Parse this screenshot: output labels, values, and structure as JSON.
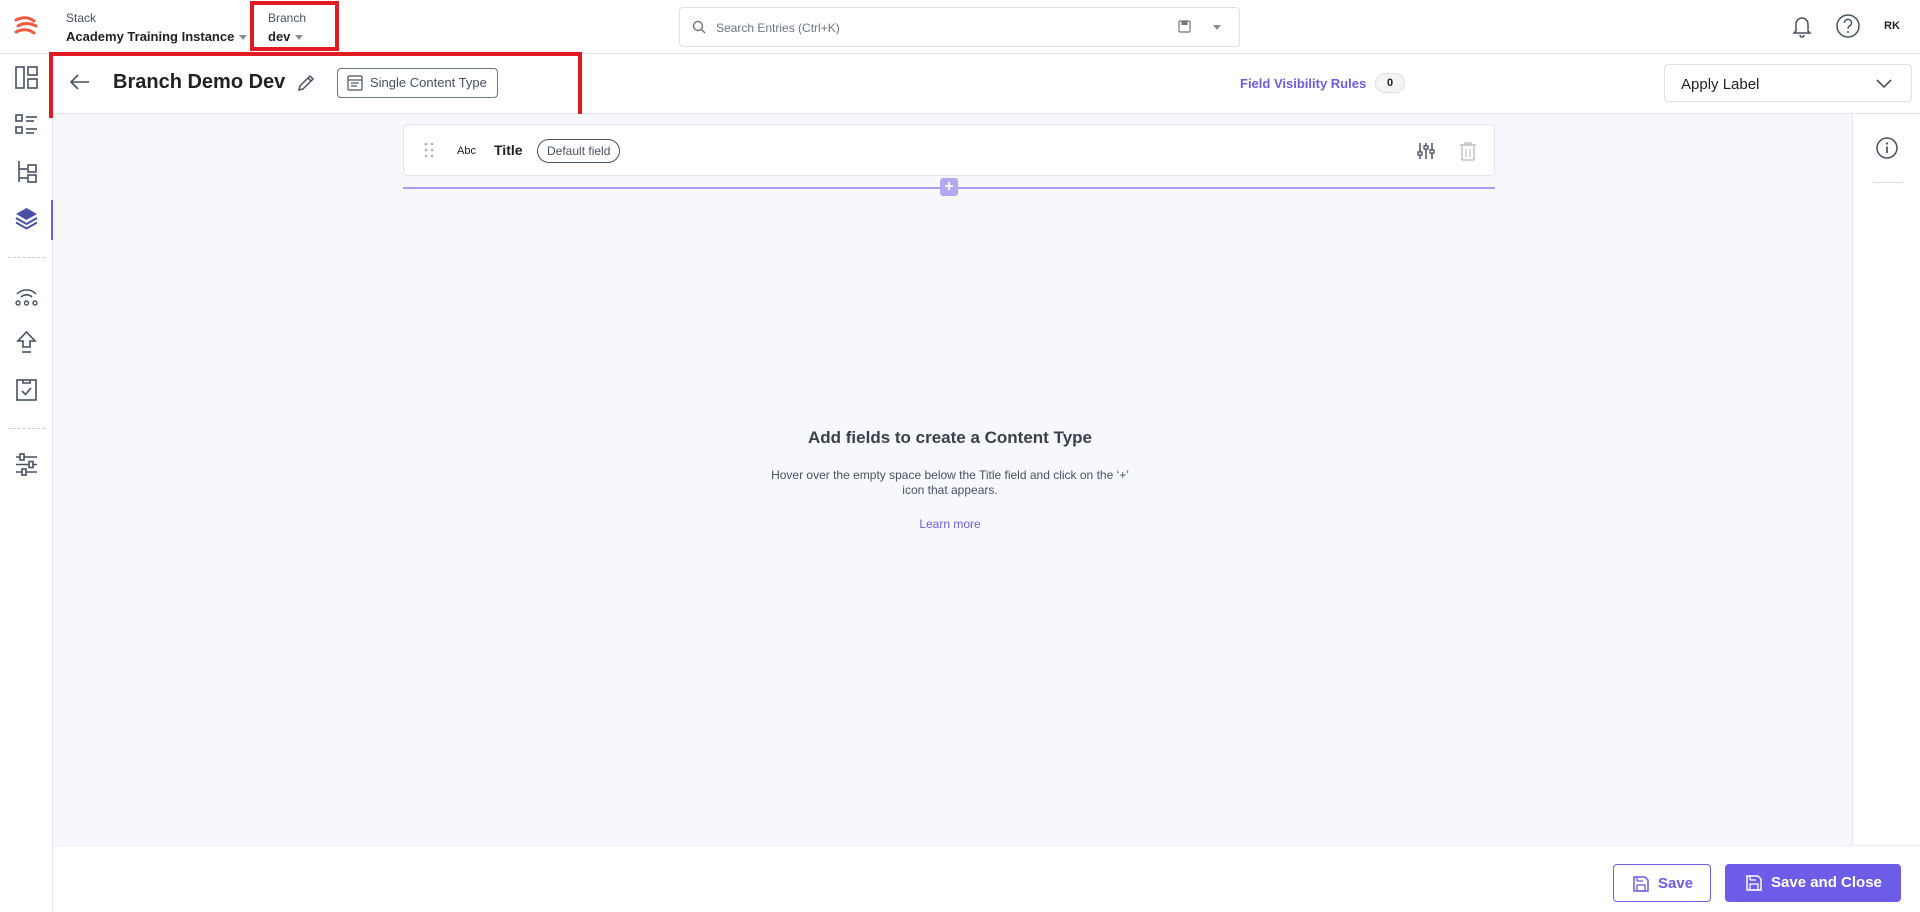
{
  "topbar": {
    "stack_label": "Stack",
    "stack_name": "Academy Training Instance",
    "branch_label": "Branch",
    "branch_name": "dev",
    "search_placeholder": "Search Entries (Ctrl+K)",
    "avatar_initials": "RK"
  },
  "header": {
    "title": "Branch Demo Dev",
    "content_type_badge": "Single Content Type",
    "field_visibility_rules_label": "Field Visibility Rules",
    "field_visibility_rules_count": "0",
    "apply_label": "Apply Label"
  },
  "field": {
    "type_abbr": "Abc",
    "name": "Title",
    "badge": "Default field"
  },
  "empty_state": {
    "title": "Add fields to create a Content Type",
    "description": "Hover over the empty space below the Title field and click on the ‘+’ icon that appears.",
    "learn_more": "Learn more"
  },
  "footer": {
    "save_label": "Save",
    "save_and_close_label": "Save and Close"
  },
  "icons": {
    "sidebar": [
      "dashboard-icon",
      "entries-icon",
      "content-models-icon",
      "stack-layers-icon",
      "releases-icon",
      "publish-queue-icon",
      "tasks-icon",
      "settings-icon"
    ]
  },
  "colors": {
    "accent": "#6c5ce7",
    "highlight_box": "#e01b24",
    "logo": "#f05a3c"
  }
}
